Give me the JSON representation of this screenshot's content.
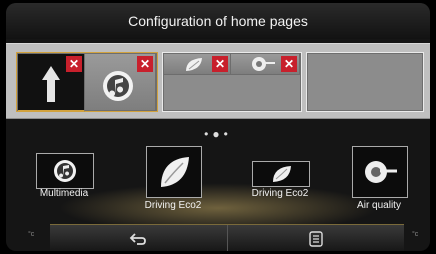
{
  "header": {
    "title": "Configuration of home pages"
  },
  "slots": [
    {
      "tiles": [
        "navigation-arrow-icon",
        "multimedia-icon"
      ]
    },
    {
      "tiles": [
        "driving-eco-icon",
        "air-quality-icon"
      ]
    },
    {
      "tiles": []
    }
  ],
  "pager": {
    "dots": "•●•"
  },
  "widgets": [
    {
      "label": "Multimedia",
      "icon": "multimedia-icon"
    },
    {
      "label": "Driving Eco2",
      "icon": "driving-eco-icon"
    },
    {
      "label": "Driving Eco2",
      "icon": "driving-eco-icon"
    },
    {
      "label": "Air quality",
      "icon": "air-quality-icon"
    }
  ],
  "delete_glyph": "✕",
  "bottom": {
    "back_icon": "back-arrow-icon",
    "menu_icon": "menu-list-icon",
    "temp_left": "°c",
    "temp_right": "°c"
  },
  "colors": {
    "selected": "#d2a23d",
    "delete": "#c8202c"
  }
}
